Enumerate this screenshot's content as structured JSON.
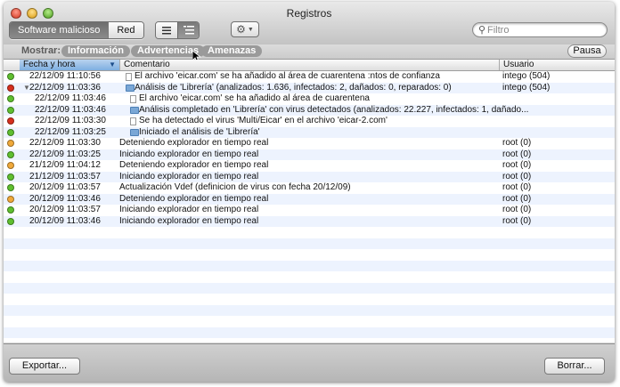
{
  "window": {
    "title": "Registros"
  },
  "tabs": [
    {
      "label": "Software malicioso",
      "selected": true
    },
    {
      "label": "Red",
      "selected": false
    }
  ],
  "toolbar": {
    "view_list_icon": "list-icon",
    "view_tree_icon": "tree-list-icon",
    "action_icon": "gear-icon"
  },
  "search": {
    "placeholder": "Filtro",
    "value": ""
  },
  "filters": {
    "label": "Mostrar:",
    "items": [
      "Información",
      "Advertencias",
      "Amenazas"
    ],
    "pause_label": "Pausa"
  },
  "table": {
    "columns": [
      "Fecha y hora",
      "Comentario",
      "Usuario"
    ],
    "rows": [
      {
        "level": "green",
        "date": "22/12/09 11:10:56",
        "comment": "El archivo 'eicar.com' se ha añadido al área de cuarentena  :ntos de confianza",
        "user": "intego (504)",
        "indent": 0,
        "icon": "doc"
      },
      {
        "level": "red",
        "date": "22/12/09 11:03:36",
        "comment": "Análisis de 'Librería' (analizados: 1.636, infectados: 2, dañados: 0, reparados: 0)",
        "user": "intego (504)",
        "indent": 0,
        "icon": "folder",
        "expanded": true
      },
      {
        "level": "green",
        "date": "22/12/09 11:03:46",
        "comment": "El archivo 'eicar.com' se ha añadido al área de cuarentena",
        "user": "",
        "indent": 1,
        "icon": "doc"
      },
      {
        "level": "green",
        "date": "22/12/09 11:03:46",
        "comment": "Análisis completado en 'Librería' con virus detectados (analizados: 22.227, infectados: 1, dañado...",
        "user": "",
        "indent": 1,
        "icon": "folder"
      },
      {
        "level": "red",
        "date": "22/12/09 11:03:30",
        "comment": "Se ha detectado el virus 'Multi/Eicar' en el archivo 'eicar-2.com'",
        "user": "",
        "indent": 1,
        "icon": "doc"
      },
      {
        "level": "green",
        "date": "22/12/09 11:03:25",
        "comment": "Iniciado el análisis de 'Librería'",
        "user": "",
        "indent": 1,
        "icon": "folder"
      },
      {
        "level": "orange",
        "date": "22/12/09 11:03:30",
        "comment": "Deteniendo explorador en tiempo real",
        "user": "root (0)",
        "indent": 0,
        "icon": ""
      },
      {
        "level": "green",
        "date": "22/12/09 11:03:25",
        "comment": "Iniciando explorador en tiempo real",
        "user": "root (0)",
        "indent": 0,
        "icon": ""
      },
      {
        "level": "orange",
        "date": "21/12/09 11:04:12",
        "comment": "Deteniendo explorador en tiempo real",
        "user": "root (0)",
        "indent": 0,
        "icon": ""
      },
      {
        "level": "green",
        "date": "21/12/09 11:03:57",
        "comment": "Iniciando explorador en tiempo real",
        "user": "root (0)",
        "indent": 0,
        "icon": ""
      },
      {
        "level": "green",
        "date": "20/12/09 11:03:57",
        "comment": "Actualización Vdef (definicion de virus con fecha 20/12/09)",
        "user": "root (0)",
        "indent": 0,
        "icon": ""
      },
      {
        "level": "orange",
        "date": "20/12/09 11:03:46",
        "comment": "Deteniendo explorador en tiempo real",
        "user": "root (0)",
        "indent": 0,
        "icon": ""
      },
      {
        "level": "green",
        "date": "20/12/09 11:03:57",
        "comment": "Iniciando explorador en tiempo real",
        "user": "root (0)",
        "indent": 0,
        "icon": ""
      },
      {
        "level": "green",
        "date": "20/12/09 11:03:46",
        "comment": "Iniciando explorador en tiempo real",
        "user": "root (0)",
        "indent": 0,
        "icon": ""
      }
    ]
  },
  "footer": {
    "export_label": "Exportar...",
    "clear_label": "Borrar..."
  },
  "colors": {
    "green": "#5fbf2f",
    "red": "#d6301e",
    "orange": "#f0a93a",
    "sorted_header": "#8fb9e6"
  }
}
